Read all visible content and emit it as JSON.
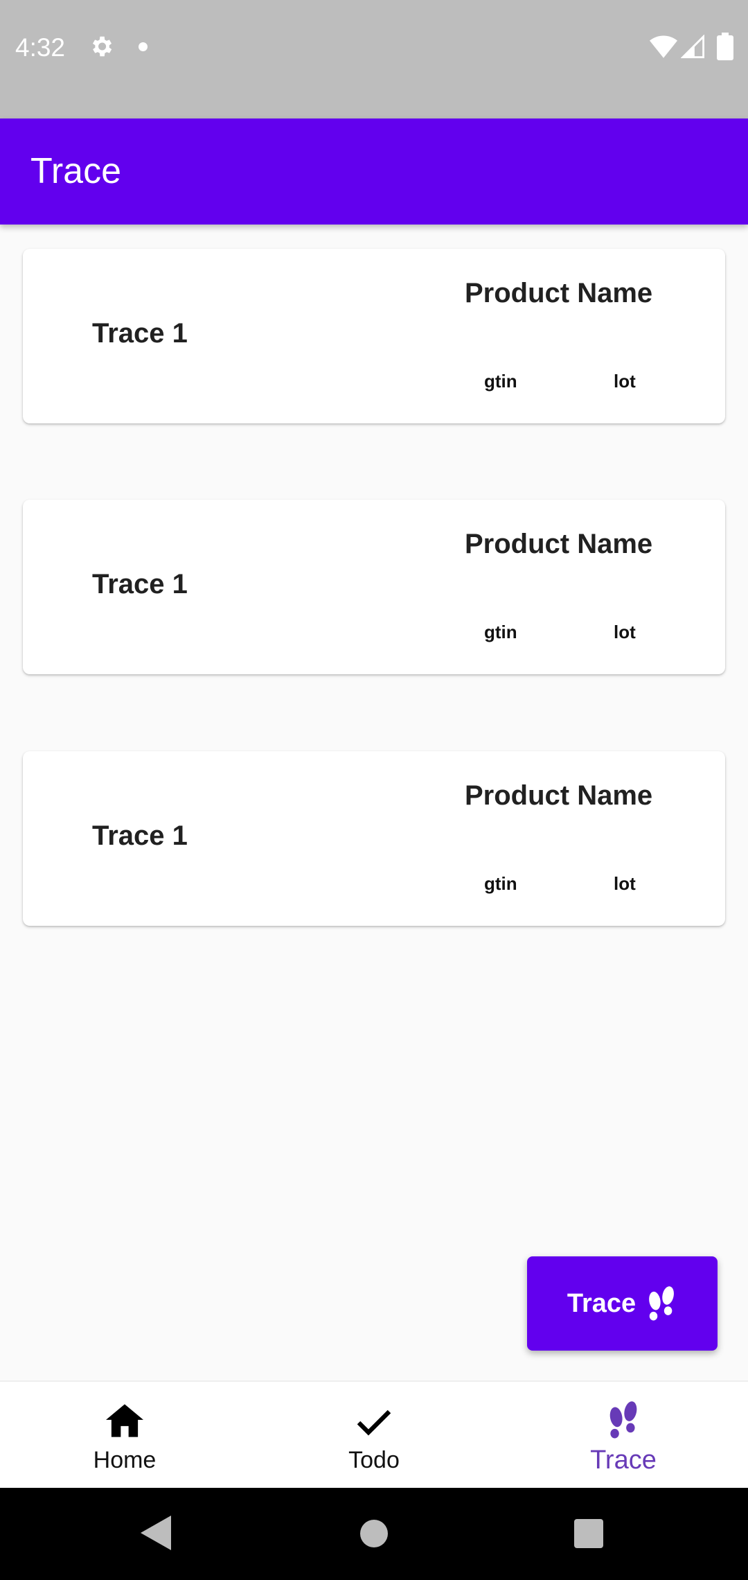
{
  "status_bar": {
    "time": "4:32"
  },
  "app_bar": {
    "title": "Trace"
  },
  "cards": [
    {
      "title": "Trace 1",
      "product_label": "Product Name",
      "gtin_label": "gtin",
      "lot_label": "lot"
    },
    {
      "title": "Trace 1",
      "product_label": "Product Name",
      "gtin_label": "gtin",
      "lot_label": "lot"
    },
    {
      "title": "Trace 1",
      "product_label": "Product Name",
      "gtin_label": "gtin",
      "lot_label": "lot"
    }
  ],
  "fab": {
    "label": "Trace",
    "icon": "footprints-icon"
  },
  "bottom_nav": {
    "items": [
      {
        "label": "Home",
        "icon": "home-icon",
        "active": false
      },
      {
        "label": "Todo",
        "icon": "check-icon",
        "active": false
      },
      {
        "label": "Trace",
        "icon": "footprints-icon",
        "active": true
      }
    ]
  },
  "colors": {
    "primary": "#6200ee",
    "active_nav": "#673ab7",
    "status_bar": "#bdbdbd"
  }
}
